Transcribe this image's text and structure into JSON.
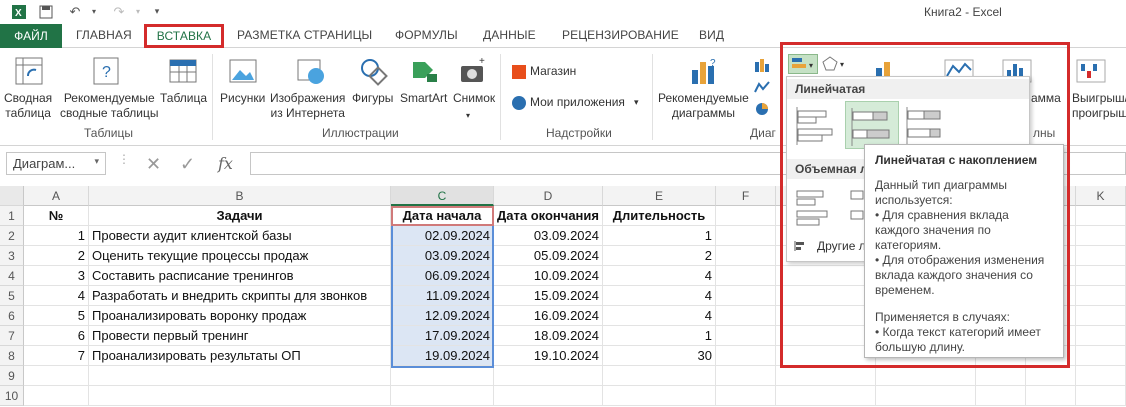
{
  "title": "Книга2 - Excel",
  "tabs": [
    "ФАЙЛ",
    "ГЛАВНАЯ",
    "ВСТАВКА",
    "РАЗМЕТКА СТРАНИЦЫ",
    "ФОРМУЛЫ",
    "ДАННЫЕ",
    "РЕЦЕНЗИРОВАНИЕ",
    "ВИД"
  ],
  "ribbon": {
    "pivot": "Сводная\nтаблица",
    "recpivot": "Рекомендуемые\nсводные таблицы",
    "table": "Таблица",
    "g_tables": "Таблицы",
    "pictures": "Рисунки",
    "online": "Изображения\nиз Интернета",
    "shapes": "Фигуры",
    "smartart": "SmartArt",
    "screenshot": "Снимок",
    "g_illus": "Иллюстрации",
    "store": "Магазин",
    "myapps": "Мои приложения",
    "g_addins": "Надстройки",
    "recchart": "Рекомендуемые\nдиаграммы",
    "g_charts": "Диаг",
    "partial1": "амма",
    "winloss": "Выигрыш/\nпроигрыш",
    "partial2": "лны"
  },
  "formula": {
    "namebox": "Диаграм..."
  },
  "columns": [
    "A",
    "B",
    "C",
    "D",
    "E",
    "F",
    "",
    "",
    "",
    "",
    "K"
  ],
  "rows": [
    {
      "n": "1",
      "a": "№",
      "b": "Задачи",
      "c": "Дата начала",
      "d": "Дата окончания",
      "e": "Длительность"
    },
    {
      "n": "2",
      "a": "1",
      "b": "Провести аудит клиентской базы",
      "c": "02.09.2024",
      "d": "03.09.2024",
      "e": "1"
    },
    {
      "n": "3",
      "a": "2",
      "b": "Оценить текущие процессы продаж",
      "c": "03.09.2024",
      "d": "05.09.2024",
      "e": "2"
    },
    {
      "n": "4",
      "a": "3",
      "b": "Составить расписание тренингов",
      "c": "06.09.2024",
      "d": "10.09.2024",
      "e": "4"
    },
    {
      "n": "5",
      "a": "4",
      "b": "Разработать и внедрить скрипты для звонков",
      "c": "11.09.2024",
      "d": "15.09.2024",
      "e": "4"
    },
    {
      "n": "6",
      "a": "5",
      "b": "Проанализировать воронку продаж",
      "c": "12.09.2024",
      "d": "16.09.2024",
      "e": "4"
    },
    {
      "n": "7",
      "a": "6",
      "b": "Провести первый тренинг",
      "c": "17.09.2024",
      "d": "18.09.2024",
      "e": "1"
    },
    {
      "n": "8",
      "a": "7",
      "b": "Проанализировать результаты ОП",
      "c": "19.09.2024",
      "d": "19.10.2024",
      "e": "30"
    },
    {
      "n": "9",
      "a": "",
      "b": "",
      "c": "",
      "d": "",
      "e": ""
    },
    {
      "n": "10",
      "a": "",
      "b": "",
      "c": "",
      "d": "",
      "e": ""
    }
  ],
  "dropdown": {
    "sec1": "Линейчатая",
    "sec2": "Объемная л",
    "other": "Другие л"
  },
  "tooltip": {
    "title": "Линейчатая с накоплением",
    "l1": "Данный тип диаграммы используется:",
    "l2": "• Для сравнения вклада каждого значения по категориям.",
    "l3": "• Для отображения изменения вклада каждого значения со временем.",
    "l4": "Применяется в случаях:",
    "l5": "• Когда текст категорий имеет большую длину."
  },
  "colors": {
    "excel_green": "#217346",
    "highlight_red": "#d42b2b",
    "selection_blue": "#dce6f4"
  }
}
